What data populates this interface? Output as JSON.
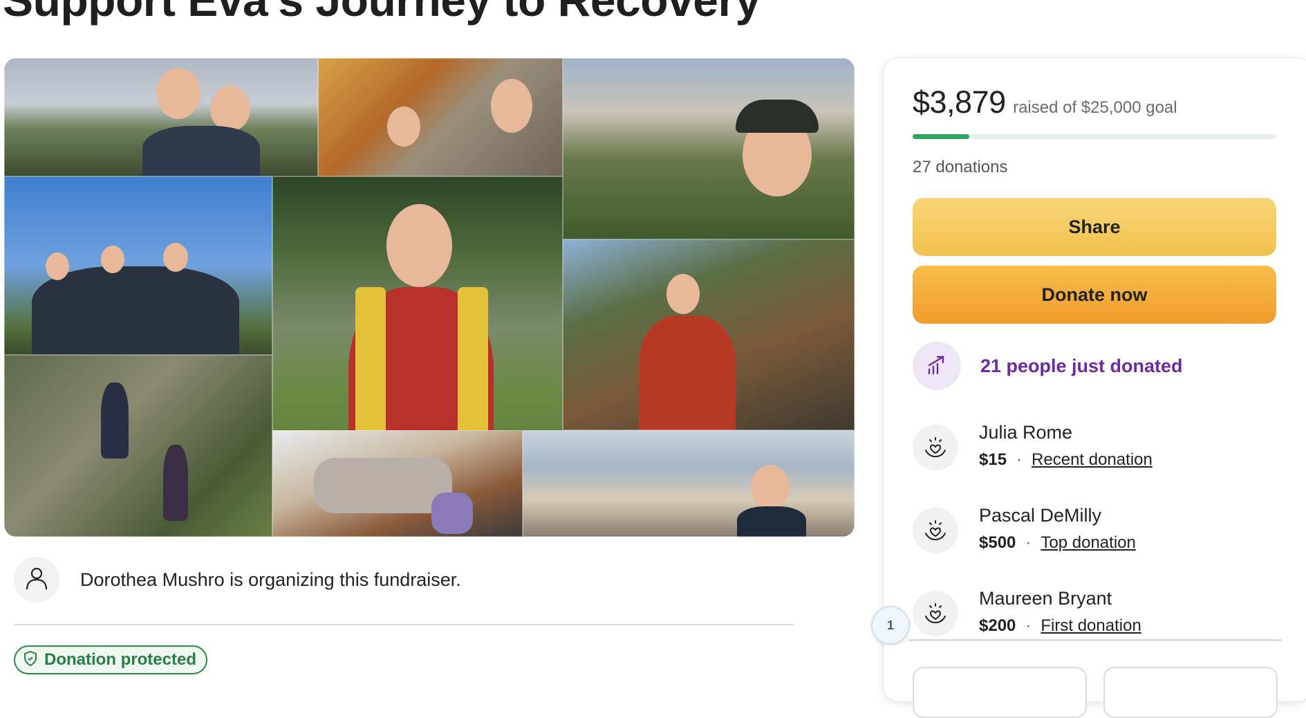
{
  "page": {
    "title": "Support Eva's Journey to Recovery"
  },
  "collage": {
    "photo_count": 9
  },
  "organizer": {
    "text": "Dorothea Mushro is organizing this fundraiser."
  },
  "badge": {
    "label": "Donation protected"
  },
  "donation_panel": {
    "raised": "$3,879",
    "goal_text": "raised of $25,000 goal",
    "progress_fraction": 0.155,
    "donation_count": "27 donations",
    "share_label": "Share",
    "donate_label": "Donate now",
    "trend_text": "21 people just donated",
    "donors": [
      {
        "name": "Julia Rome",
        "amount": "$15",
        "tag": "Recent donation"
      },
      {
        "name": "Pascal DeMilly",
        "amount": "$500",
        "tag": "Top donation"
      },
      {
        "name": "Maureen Bryant",
        "amount": "$200",
        "tag": "First donation"
      }
    ]
  },
  "pager": {
    "label": "1"
  },
  "colors": {
    "progress": "#2ea262",
    "trend": "#6b2aa3",
    "share": "#f1c04c",
    "donate": "#f09c2e",
    "protected": "#2a7d45"
  },
  "icons": {
    "organizer": "person-icon",
    "badge": "shield-icon",
    "trend": "trending-up-icon",
    "donor": "heart-hands-icon"
  }
}
